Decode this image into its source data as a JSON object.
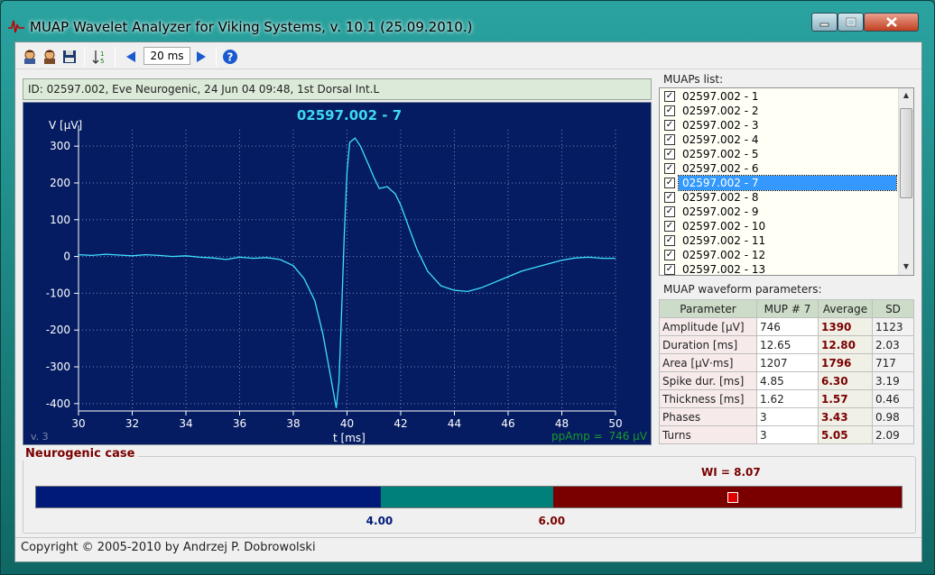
{
  "window": {
    "title": "MUAP Wavelet Analyzer for Viking Systems, v. 10.1 (25.09.2010.)"
  },
  "toolbar": {
    "zoom_value": "20 ms",
    "icons": [
      "patient-open-icon",
      "patient-save-icon",
      "floppy-disk-icon",
      "sort-icon",
      "prev-arrow-icon",
      "next-arrow-icon",
      "help-icon"
    ]
  },
  "record_id": "ID: 02597.002, Eve Neurogenic, 24 Jun 04 09:48, 1st Dorsal Int.L",
  "plot": {
    "title": "02597.002 - 7",
    "ylabel": "V [µV]",
    "xlabel": "t [ms]",
    "version": "v. 3",
    "ppamp_label": "ppAmp =",
    "ppamp_value": "746 µV"
  },
  "chart_data": {
    "type": "line",
    "title": "02597.002 - 7",
    "xlabel": "t [ms]",
    "ylabel": "V [µV]",
    "xlim": [
      30,
      50
    ],
    "ylim": [
      -420,
      340
    ],
    "xticks": [
      30,
      32,
      34,
      36,
      38,
      40,
      42,
      44,
      46,
      48,
      50
    ],
    "yticks": [
      300,
      200,
      100,
      0,
      -100,
      -200,
      -300,
      -400
    ],
    "grid": true,
    "series": [
      {
        "color": "#3fe0ff",
        "x": [
          30,
          30.5,
          31,
          31.5,
          32,
          32.5,
          33,
          33.5,
          34,
          34.5,
          35,
          35.5,
          36,
          36.5,
          37,
          37.5,
          38,
          38.4,
          38.8,
          39.1,
          39.4,
          39.6,
          39.7,
          39.8,
          39.9,
          40.0,
          40.1,
          40.3,
          40.5,
          40.8,
          41.0,
          41.2,
          41.5,
          41.8,
          42.0,
          42.3,
          42.6,
          43.0,
          43.5,
          44.0,
          44.5,
          45.0,
          45.5,
          46.0,
          46.5,
          47.0,
          47.5,
          48.0,
          48.5,
          49.0,
          49.5,
          50
        ],
        "y": [
          5,
          3,
          6,
          4,
          2,
          5,
          3,
          0,
          2,
          -2,
          -4,
          -8,
          -2,
          -5,
          -3,
          -8,
          -25,
          -60,
          -120,
          -210,
          -330,
          -412,
          -340,
          -150,
          60,
          230,
          310,
          322,
          300,
          250,
          215,
          185,
          190,
          170,
          140,
          80,
          20,
          -40,
          -80,
          -92,
          -95,
          -85,
          -70,
          -55,
          -40,
          -30,
          -20,
          -10,
          -4,
          -2,
          -5,
          -5
        ]
      }
    ]
  },
  "muaps": {
    "label": "MUAPs list:",
    "items": [
      {
        "name": "02597.002 - 1",
        "checked": true
      },
      {
        "name": "02597.002 - 2",
        "checked": true
      },
      {
        "name": "02597.002 - 3",
        "checked": true
      },
      {
        "name": "02597.002 - 4",
        "checked": true
      },
      {
        "name": "02597.002 - 5",
        "checked": true
      },
      {
        "name": "02597.002 - 6",
        "checked": true
      },
      {
        "name": "02597.002 - 7",
        "checked": true
      },
      {
        "name": "02597.002 - 8",
        "checked": true
      },
      {
        "name": "02597.002 - 9",
        "checked": true
      },
      {
        "name": "02597.002 - 10",
        "checked": true
      },
      {
        "name": "02597.002 - 11",
        "checked": true
      },
      {
        "name": "02597.002 - 12",
        "checked": true
      },
      {
        "name": "02597.002 - 13",
        "checked": true
      }
    ],
    "selected_index": 6
  },
  "params": {
    "label": "MUAP waveform parameters:",
    "headers": [
      "Parameter",
      "MUP # 7",
      "Average",
      "SD"
    ],
    "rows": [
      [
        "Amplitude [µV]",
        "746",
        "1390",
        "1123"
      ],
      [
        "Duration [ms]",
        "12.65",
        "12.80",
        "2.03"
      ],
      [
        "Area [µV·ms]",
        "1207",
        "1796",
        "717"
      ],
      [
        "Spike dur. [ms]",
        "4.85",
        "6.30",
        "3.19"
      ],
      [
        "Thickness [ms]",
        "1.62",
        "1.57",
        "0.46"
      ],
      [
        "Phases",
        "3",
        "3.43",
        "0.98"
      ],
      [
        "Turns",
        "3",
        "5.05",
        "2.09"
      ]
    ]
  },
  "neuro": {
    "label": "Neurogenic case",
    "wi_label": "WI = 8.07",
    "wi_value": 8.07,
    "threshold_low": "4.00",
    "threshold_high": "6.00",
    "scale_fractions": [
      0.398,
      0.199,
      0.403
    ],
    "marker_fraction": 0.805,
    "colors": {
      "low": "#001a7a",
      "mid": "#00807a",
      "high": "#7a0000",
      "marker": "#e00000"
    }
  },
  "status": "Copyright © 2005-2010 by Andrzej P. Dobrowolski"
}
